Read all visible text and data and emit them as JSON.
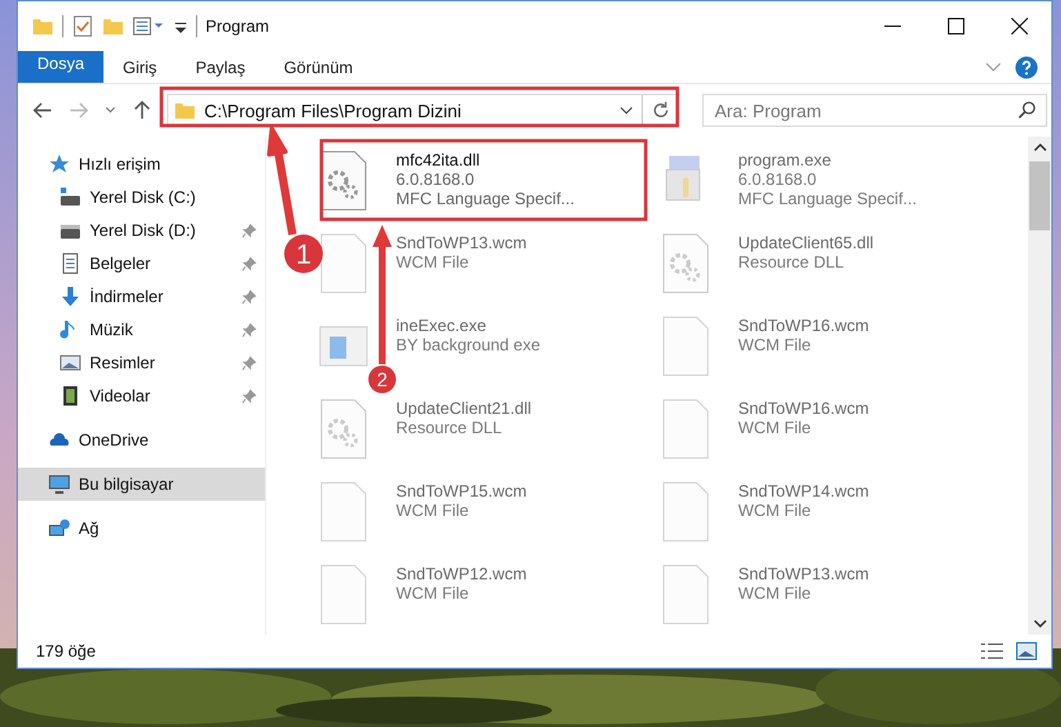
{
  "window": {
    "title": "Program"
  },
  "ribbon_tabs": [
    {
      "label": "Dosya",
      "kind": "file"
    },
    {
      "label": "Giriş",
      "kind": "tab"
    },
    {
      "label": "Paylaş",
      "kind": "tab"
    },
    {
      "label": "Görünüm",
      "kind": "tab"
    }
  ],
  "address_bar": {
    "path": "C:\\Program Files\\Program Dizini"
  },
  "search": {
    "placeholder": "Ara: Program"
  },
  "sidebar": {
    "items": [
      {
        "label": "Hızlı erişim",
        "selected": false,
        "children": [
          {
            "label": "Yerel Disk (C:)",
            "pinned": false,
            "selected": false
          },
          {
            "label": "Yerel Disk (D:)",
            "pinned": true,
            "selected": false
          },
          {
            "label": "Belgeler",
            "pinned": true,
            "selected": false
          },
          {
            "label": "İndirmeler",
            "pinned": true,
            "selected": false
          },
          {
            "label": "Müzik",
            "pinned": true,
            "selected": false
          },
          {
            "label": "Resimler",
            "pinned": true,
            "selected": false
          },
          {
            "label": "Videolar",
            "pinned": true,
            "selected": false
          }
        ]
      },
      {
        "label": "OneDrive",
        "selected": false
      },
      {
        "label": "Bu bilgisayar",
        "selected": true
      },
      {
        "label": "Ağ",
        "selected": false
      }
    ]
  },
  "files": [
    {
      "name": "mfc42ita.dll",
      "lines": [
        "6.0.8168.0",
        "MFC Language Specif..."
      ],
      "kind": "dll",
      "dimmed": false
    },
    {
      "name": "program.exe",
      "lines": [
        "6.0.8168.0",
        "MFC Language Specif..."
      ],
      "kind": "app",
      "dimmed": true
    },
    {
      "name": "SndToWP13.wcm",
      "lines": [
        "WCM File"
      ],
      "kind": "blank",
      "dimmed": true
    },
    {
      "name": "UpdateClient65.dll",
      "lines": [
        "Resource DLL"
      ],
      "kind": "dll",
      "dimmed": true
    },
    {
      "name": "ineExec.exe",
      "lines": [
        "BY background exe"
      ],
      "kind": "exe",
      "dimmed": true
    },
    {
      "name": "SndToWP16.wcm",
      "lines": [
        "WCM File"
      ],
      "kind": "blank",
      "dimmed": true
    },
    {
      "name": "UpdateClient21.dll",
      "lines": [
        "Resource DLL"
      ],
      "kind": "dll",
      "dimmed": true
    },
    {
      "name": "SndToWP16.wcm",
      "lines": [
        "WCM File"
      ],
      "kind": "blank",
      "dimmed": true
    },
    {
      "name": "SndToWP15.wcm",
      "lines": [
        "WCM File"
      ],
      "kind": "blank",
      "dimmed": true
    },
    {
      "name": "SndToWP14.wcm",
      "lines": [
        "WCM File"
      ],
      "kind": "blank",
      "dimmed": true
    },
    {
      "name": "SndToWP12.wcm",
      "lines": [
        "WCM File"
      ],
      "kind": "blank",
      "dimmed": true
    },
    {
      "name": "SndToWP13.wcm",
      "lines": [
        "WCM File"
      ],
      "kind": "blank",
      "dimmed": true
    }
  ],
  "status_bar": {
    "count": "179 öğe"
  },
  "annotations": [
    {
      "label": "1"
    },
    {
      "label": "2"
    }
  ]
}
